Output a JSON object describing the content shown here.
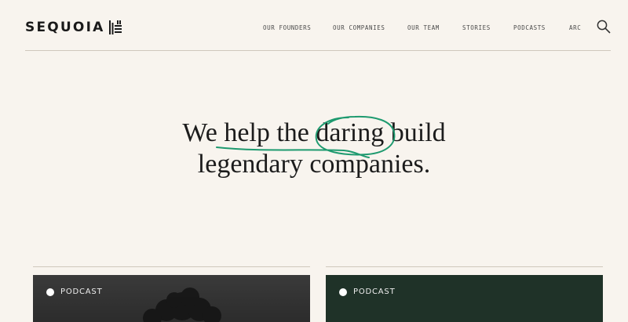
{
  "header": {
    "logo_text": "SEQUOIA",
    "nav": [
      "OUR FOUNDERS",
      "OUR COMPANIES",
      "OUR TEAM",
      "STORIES",
      "PODCASTS",
      "ARC"
    ],
    "search_icon": "search-icon"
  },
  "hero": {
    "line1_prefix": "We ",
    "line1_underline": "help the",
    "line1_space": " ",
    "line1_circled": "daring",
    "line1_suffix": " build",
    "line2": "legendary companies."
  },
  "cards": [
    {
      "tag": "PODCAST"
    },
    {
      "tag": "PODCAST"
    }
  ],
  "colors": {
    "background": "#f8f4ee",
    "accent_scribble": "#1e9a6f",
    "divider": "#cfc8bd"
  }
}
